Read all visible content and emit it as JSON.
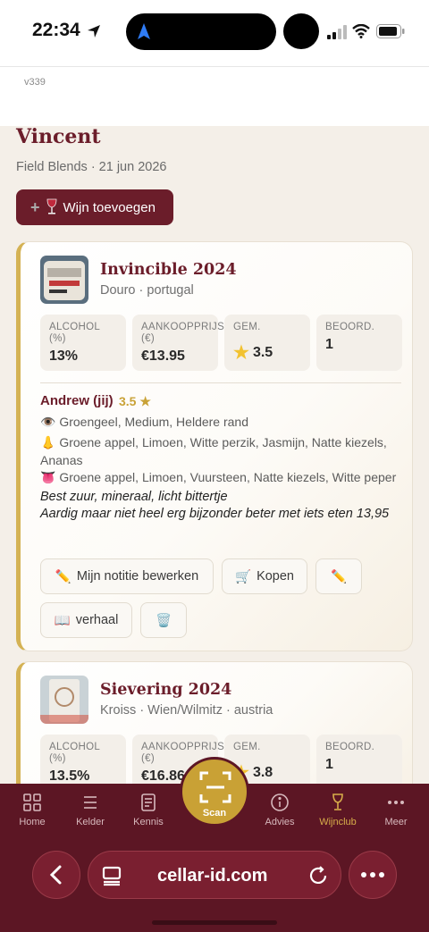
{
  "status": {
    "time": "22:34"
  },
  "app": {
    "version": "v339"
  },
  "page": {
    "title": "Vincent",
    "subtitle": "Field Blends · 21 jun 2026"
  },
  "add_wine_button": {
    "label": "Wijn toevoegen",
    "icon": "wine-glass-icon"
  },
  "wines": [
    {
      "name": "Invincible 2024",
      "origin": "Douro · portugal",
      "stats": [
        {
          "label": "ALCOHOL (%)",
          "value": "13%"
        },
        {
          "label": "AANKOOPPRIJS (€)",
          "value": "€13.95"
        },
        {
          "label": "GEM.",
          "value": "3.5"
        },
        {
          "label": "BEOORD.",
          "value": "1"
        }
      ],
      "review": {
        "reviewer": "Andrew (jij)",
        "score": "3.5 ★",
        "appearance": "Groengeel, Medium, Heldere rand",
        "nose": "Groene appel, Limoen, Witte perzik, Jasmijn, Natte kiezels, Ananas",
        "palate": "Groene appel, Limoen, Vuursteen, Natte kiezels, Witte peper",
        "note1": "Best zuur, mineraal, licht bittertje",
        "note2": "Aardig maar niet heel erg bijzonder beter met iets eten 13,95"
      },
      "actions": {
        "edit_note": "Mijn notitie bewerken",
        "buy": "Kopen",
        "story": "verhaal"
      }
    },
    {
      "name": "Sievering 2024",
      "origin": "Kroiss · Wien/Wilmitz · austria",
      "stats": [
        {
          "label": "ALCOHOL (%)",
          "value": "13.5%"
        },
        {
          "label": "AANKOOPPRIJS (€)",
          "value": "€16.86"
        },
        {
          "label": "GEM.",
          "value": "3.8"
        },
        {
          "label": "BEOORD.",
          "value": "1"
        }
      ]
    }
  ],
  "tabs": [
    {
      "label": "Home",
      "icon": "grid-icon"
    },
    {
      "label": "Kelder",
      "icon": "list-icon"
    },
    {
      "label": "Kennis",
      "icon": "book-icon"
    },
    {
      "label": "Scan",
      "icon": "scan-icon"
    },
    {
      "label": "Advies",
      "icon": "info-icon"
    },
    {
      "label": "Wijnclub",
      "icon": "wine-glass-icon",
      "active": true
    },
    {
      "label": "Meer",
      "icon": "more-icon"
    }
  ],
  "browser": {
    "url": "cellar-id.com"
  },
  "colors": {
    "primary": "#6b1d2a",
    "accent": "#d4b254",
    "tabbar": "#5c1624"
  }
}
